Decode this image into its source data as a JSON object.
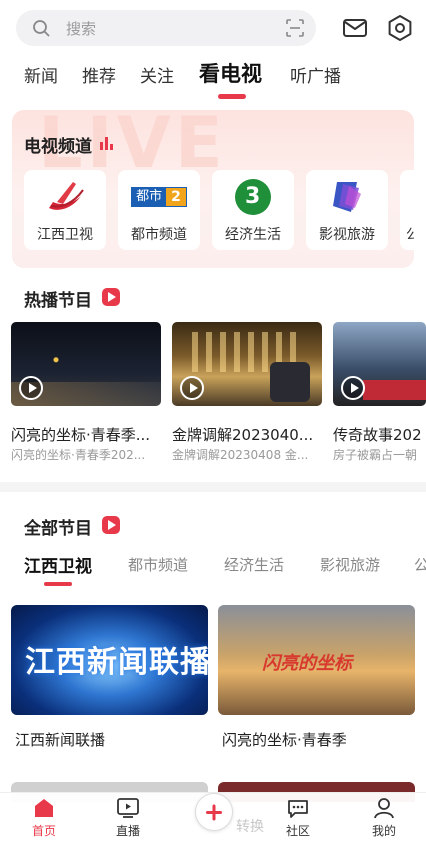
{
  "search": {
    "placeholder": "搜索"
  },
  "nav": {
    "tabs": [
      "新闻",
      "推荐",
      "关注",
      "看电视",
      "听广播"
    ],
    "active_index": 3
  },
  "tv_channels": {
    "title": "电视频道",
    "items": [
      {
        "label": "江西卫视",
        "icon": "jiangxi-tv-logo"
      },
      {
        "label": "都市频道",
        "icon": "dushi-channel-logo",
        "logo_text": "都市",
        "logo_num": "2"
      },
      {
        "label": "经济生活",
        "icon": "economy-life-logo",
        "logo_num": "3"
      },
      {
        "label": "影视旅游",
        "icon": "film-travel-logo"
      },
      {
        "label": "公"
      }
    ],
    "watermark": "LIVE"
  },
  "hot_programs": {
    "title": "热播节目",
    "items": [
      {
        "title": "闪亮的坐标·青春季...",
        "subtitle": "闪亮的坐标·青春季202..."
      },
      {
        "title": "金牌调解2023040...",
        "subtitle": "金牌调解20230408 金..."
      },
      {
        "title": "传奇故事202",
        "subtitle": "房子被霸占一朝"
      }
    ]
  },
  "all_programs": {
    "title": "全部节目",
    "tabs": [
      "江西卫视",
      "都市频道",
      "经济生活",
      "影视旅游",
      "公"
    ],
    "active_index": 0,
    "items": [
      {
        "title": "江西新闻联播",
        "thumb_text": "江西新闻联播"
      },
      {
        "title": "闪亮的坐标·青春季",
        "thumb_text": "闪亮的坐标"
      }
    ]
  },
  "bottom_nav": {
    "items": [
      {
        "label": "首页",
        "icon": "home-icon"
      },
      {
        "label": "直播",
        "icon": "live-tv-icon"
      },
      {
        "label": "社区",
        "icon": "chat-icon"
      },
      {
        "label": "我的",
        "icon": "user-icon"
      }
    ],
    "active_index": 0,
    "ghost_text": "转换"
  },
  "colors": {
    "accent": "#e8394a",
    "card_bg": "#fde3df"
  }
}
